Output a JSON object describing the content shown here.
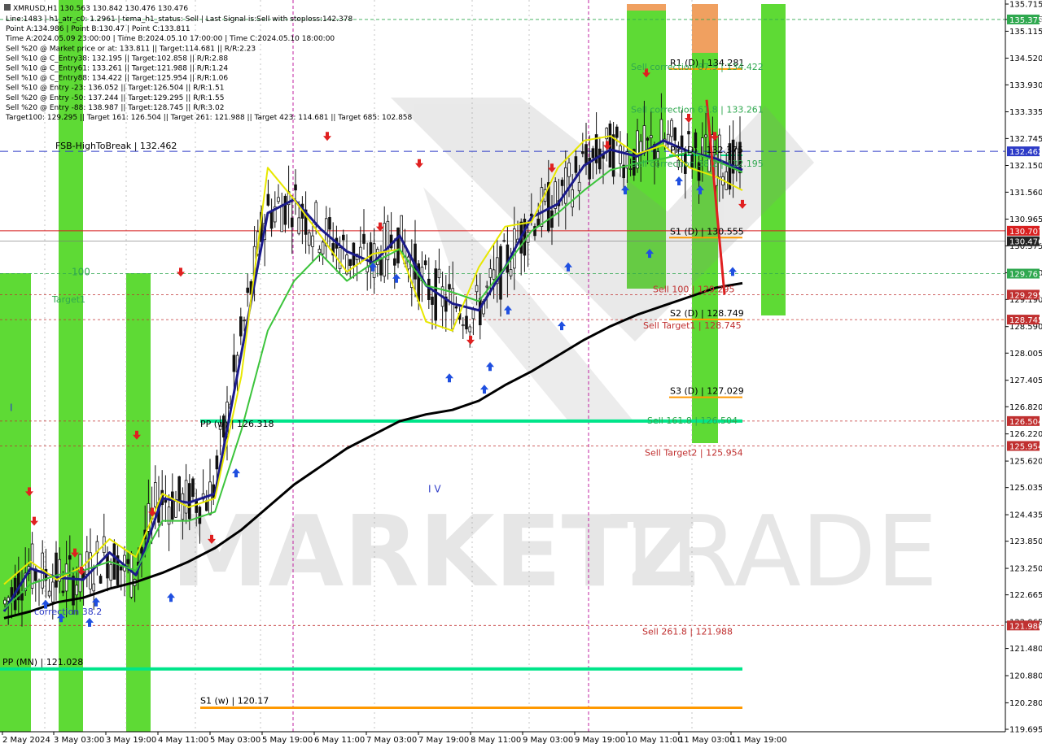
{
  "header": {
    "symbol": "XMRUSD,H1  130.563 130.842 130.476 130.476",
    "lines": [
      "Line:1483 | h1_atr_c0: 1.2961 | tema_h1_status: Sell | Last Signal is:Sell with stoploss:142.378",
      "Point A:134.986 | Point B:130.47 | Point C:133.811",
      "Time A:2024.05.09 23:00:00 | Time B:2024.05.10 17:00:00 | Time C:2024.05.10 18:00:00",
      "Sell %20 @ Market price or at: 133.811 || Target:114.681 || R/R:2.23",
      "Sell %10 @ C_Entry38: 132.195 || Target:102.858 || R/R:2.88",
      "Sell %10 @ C_Entry61: 133.261 || Target:121.988 || R/R:1.24",
      "Sell %10 @ C_Entry88: 134.422 || Target:125.954 || R/R:1.06",
      "Sell %10 @ Entry -23: 136.052 || Target:126.504 || R/R:1.51",
      "Sell %20 @ Entry -50: 137.244 || Target:129.295 || R/R:1.55",
      "Sell %20 @ Entry -88: 138.987 || Target:128.745 || R/R:3.02",
      "Target100: 129.295 || Target 161: 126.504 || Target 261: 121.988 || Target 423: 114.681 || Target 685: 102.858"
    ]
  },
  "chart_data": {
    "type": "line",
    "y_ticks": [
      "135.715",
      "135.375",
      "135.115",
      "134.520",
      "133.930",
      "133.335",
      "132.745",
      "132.150",
      "131.560",
      "130.965",
      "130.375",
      "129.780",
      "129.190",
      "128.590",
      "128.005",
      "127.405",
      "126.820",
      "126.220",
      "125.620",
      "125.035",
      "124.435",
      "123.850",
      "123.250",
      "122.665",
      "122.065",
      "121.480",
      "120.880",
      "120.280",
      "119.695"
    ],
    "x_ticks": [
      "2 May 2024",
      "3 May 03:00",
      "3 May 19:00",
      "4 May 11:00",
      "5 May 03:00",
      "5 May 19:00",
      "6 May 11:00",
      "7 May 03:00",
      "7 May 19:00",
      "8 May 11:00",
      "9 May 03:00",
      "9 May 19:00",
      "10 May 11:00",
      "11 May 03:00",
      "11 May 19:00"
    ],
    "ylim": [
      119.695,
      135.715
    ],
    "price_badges": [
      {
        "text": "135.375",
        "value": 135.375,
        "color": "#2fa84f"
      },
      {
        "text": "132.462",
        "value": 132.462,
        "color": "#2d3bc7"
      },
      {
        "text": "130.707",
        "value": 130.707,
        "color": "#d82020"
      },
      {
        "text": "130.476",
        "value": 130.476,
        "color": "#222222"
      },
      {
        "text": "129.761",
        "value": 129.761,
        "color": "#2fa84f"
      },
      {
        "text": "129.295",
        "value": 129.295,
        "color": "#c03030"
      },
      {
        "text": "128.745",
        "value": 128.745,
        "color": "#c03030"
      },
      {
        "text": "126.504",
        "value": 126.504,
        "color": "#c03030"
      },
      {
        "text": "125.954",
        "value": 125.954,
        "color": "#c03030"
      },
      {
        "text": "121.988",
        "value": 121.988,
        "color": "#c03030"
      }
    ],
    "level_labels": [
      {
        "text": "R1 (D) | 134.281",
        "value": 134.281,
        "color": "#000000"
      },
      {
        "text": "Sell correction 87.5 | 134.422",
        "value": 134.422,
        "color": "#2fa84f"
      },
      {
        "text": "Sell correction 61.8 | 133.261",
        "value": 133.261,
        "color": "#2fa84f"
      },
      {
        "text": "PP (D) | 132.375",
        "value": 132.375,
        "color": "#000000"
      },
      {
        "text": "Sell correction 38.2 | 132.195",
        "value": 132.195,
        "color": "#2fa84f"
      },
      {
        "text": "FSB-HighToBreak | 132.462",
        "value": 132.462,
        "color": "#000000"
      },
      {
        "text": "S1 (D) | 130.555",
        "value": 130.555,
        "color": "#000000"
      },
      {
        "text": "Sell 100 | 129.295",
        "value": 129.295,
        "color": "#c03030"
      },
      {
        "text": "S2 (D) | 128.749",
        "value": 128.749,
        "color": "#000000"
      },
      {
        "text": "Sell Target1 | 128.745",
        "value": 128.745,
        "color": "#c03030"
      },
      {
        "text": "S3 (D) | 127.029",
        "value": 127.029,
        "color": "#000000"
      },
      {
        "text": "PP (w) | 126.318",
        "value": 126.318,
        "color": "#000000"
      },
      {
        "text": "Sell 161.8 | 126.504",
        "value": 126.504,
        "color": "#2fa84f"
      },
      {
        "text": "Sell Target2 | 125.954",
        "value": 125.954,
        "color": "#c03030"
      },
      {
        "text": "Sell 261.8 | 121.988",
        "value": 121.988,
        "color": "#c03030"
      },
      {
        "text": "PP (MN) | 121.028",
        "value": 121.028,
        "color": "#000000"
      },
      {
        "text": "S1 (w) | 120.17",
        "value": 120.17,
        "color": "#000000"
      },
      {
        "text": "correction 38.2",
        "value": 122.3,
        "color": "#2d3bc7"
      },
      {
        "text": "100",
        "value": 129.8,
        "color": "#2fa84f"
      },
      {
        "text": "Target1",
        "value": 129.2,
        "color": "#2fa84f"
      },
      {
        "text": "I V",
        "value": 125.0,
        "color": "#2d3bc7"
      },
      {
        "text": "I",
        "value": 126.8,
        "color": "#2d3bc7"
      }
    ],
    "series": [
      {
        "name": "",
        "color": "#000000",
        "values": [
          122.15,
          122.3,
          122.5,
          122.6,
          122.8,
          122.95,
          123.15,
          123.4,
          123.7,
          124.1,
          124.6,
          125.1,
          125.5,
          125.9,
          126.2,
          126.5,
          126.65,
          126.75,
          126.95,
          127.3,
          127.6,
          127.95,
          128.3,
          128.6,
          128.85,
          129.05,
          129.25,
          129.45,
          129.55
        ]
      },
      {
        "name": "",
        "color": "#1a1a8a",
        "values": [
          122.3,
          123.25,
          123.05,
          123.0,
          123.6,
          123.1,
          124.8,
          124.7,
          124.9,
          128.0,
          131.1,
          131.4,
          130.75,
          130.25,
          130.0,
          130.6,
          129.5,
          129.1,
          128.95,
          129.9,
          131.0,
          131.3,
          132.15,
          132.5,
          132.35,
          132.7,
          132.45,
          132.3,
          132.05
        ]
      },
      {
        "name": "",
        "color": "#e8e800",
        "values": [
          122.9,
          123.4,
          123.0,
          123.3,
          123.9,
          123.5,
          124.9,
          124.6,
          124.8,
          127.5,
          132.1,
          131.4,
          130.6,
          129.8,
          130.2,
          130.3,
          128.7,
          128.5,
          129.9,
          130.8,
          130.9,
          132.1,
          132.7,
          132.8,
          132.4,
          132.6,
          132.1,
          131.9,
          131.6
        ]
      },
      {
        "name": "",
        "color": "#3cc43c",
        "values": [
          122.35,
          122.9,
          123.1,
          123.2,
          123.4,
          123.2,
          124.3,
          124.3,
          124.5,
          126.3,
          128.5,
          129.6,
          130.2,
          129.6,
          130.0,
          130.3,
          129.5,
          129.35,
          129.15,
          129.9,
          130.7,
          131.1,
          131.6,
          132.05,
          132.2,
          132.3,
          132.45,
          132.25,
          132.0
        ]
      }
    ],
    "footer_values": [
      "129.78"
    ]
  }
}
